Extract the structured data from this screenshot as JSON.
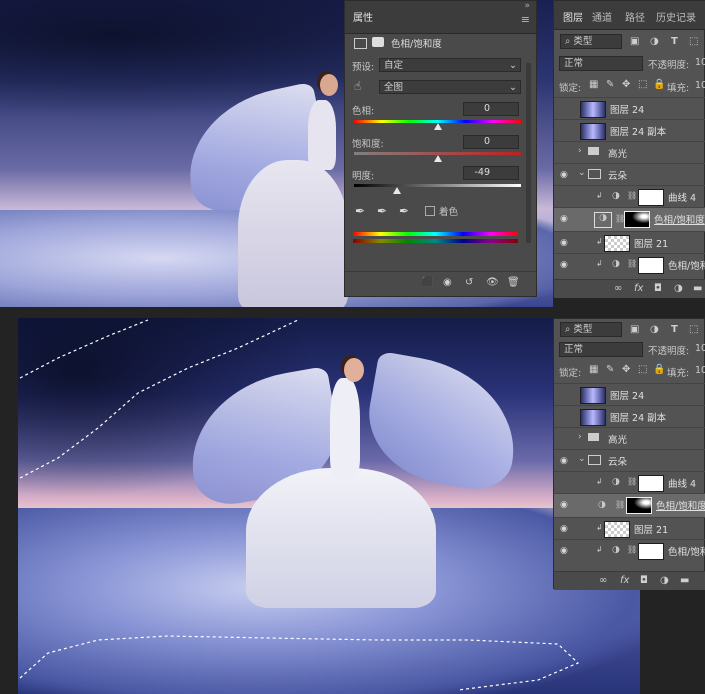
{
  "properties": {
    "tab": "属性",
    "adjustment_title": "色相/饱和度",
    "preset_label": "预设:",
    "preset_value": "自定",
    "channel_value": "全图",
    "hue_label": "色相:",
    "hue_value": "0",
    "hue": 0,
    "saturation_label": "饱和度:",
    "saturation_value": "0",
    "saturation": 0,
    "lightness_label": "明度:",
    "lightness_value": "-49",
    "lightness": -49,
    "colorize_label": "着色"
  },
  "layers_top": {
    "tabs": [
      "图层",
      "通道",
      "路径",
      "历史记录"
    ],
    "filter_label": "类型",
    "blend_mode": "正常",
    "opacity_label": "不透明度:",
    "opacity_value": "10",
    "lock_label": "锁定:",
    "fill_label": "填充:",
    "fill_value": "10",
    "rows": [
      {
        "name": "图层 24"
      },
      {
        "name": "图层 24 副本"
      },
      {
        "name": "高光"
      },
      {
        "name": "云朵"
      },
      {
        "name": "曲线 4"
      },
      {
        "name": "色相/饱和度"
      },
      {
        "name": "图层 21"
      },
      {
        "name": "色相/饱和"
      }
    ]
  },
  "layers_bottom": {
    "filter_label": "类型",
    "blend_mode": "正常",
    "opacity_label": "不透明度:",
    "opacity_value": "10",
    "lock_label": "锁定:",
    "fill_label": "填充:",
    "fill_value": "10",
    "rows": [
      {
        "name": "图层 24"
      },
      {
        "name": "图层 24 副本"
      },
      {
        "name": "高光"
      },
      {
        "name": "云朵"
      },
      {
        "name": "曲线 4"
      },
      {
        "name": "色相/饱和度"
      },
      {
        "name": "图层 21"
      },
      {
        "name": "色相/饱和"
      }
    ]
  }
}
